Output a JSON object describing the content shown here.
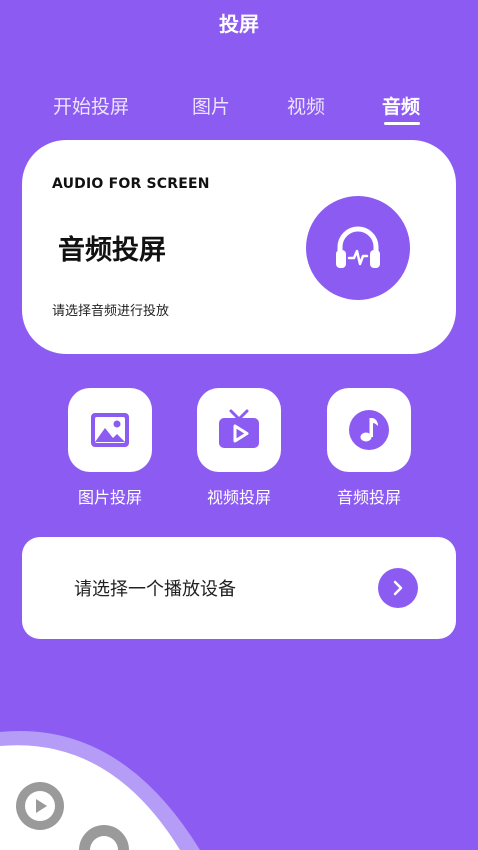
{
  "header": {
    "title": "投屏"
  },
  "tabs": [
    {
      "label": "开始投屏",
      "active": false
    },
    {
      "label": "图片",
      "active": false
    },
    {
      "label": "视频",
      "active": false
    },
    {
      "label": "音频",
      "active": true
    }
  ],
  "hero": {
    "tag": "AUDIO FOR SCREEN",
    "title": "音频投屏",
    "description": "请选择音频进行投放",
    "icon": "headphones-icon"
  },
  "shortcuts": [
    {
      "label": "图片投屏",
      "icon": "image-icon"
    },
    {
      "label": "视频投屏",
      "icon": "tv-play-icon"
    },
    {
      "label": "音频投屏",
      "icon": "music-note-icon"
    }
  ],
  "device_select": {
    "label": "请选择一个播放设备",
    "icon": "chevron-right-icon"
  },
  "colors": {
    "primary": "#8c5cf2",
    "card": "#ffffff",
    "floating_button": "#9a9a9a"
  }
}
